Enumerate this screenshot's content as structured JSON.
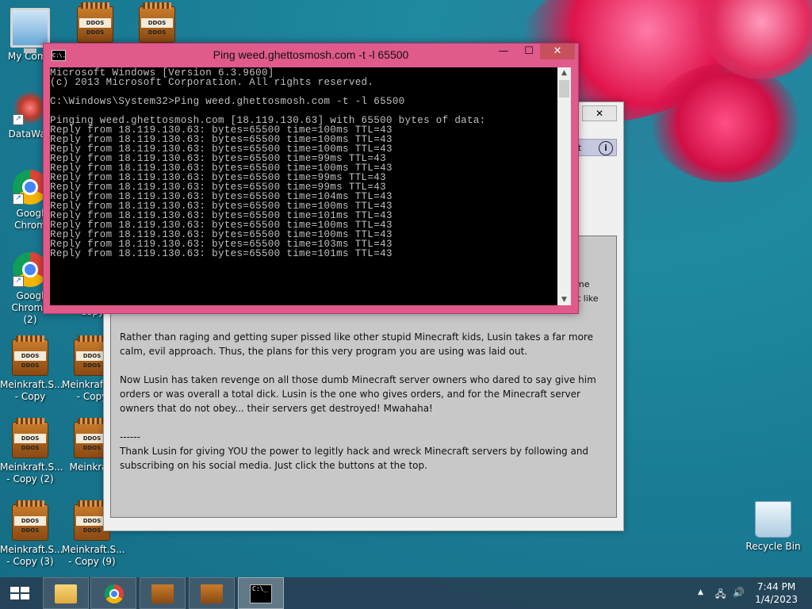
{
  "desktop": {
    "icons": [
      {
        "label": "My Comp",
        "kind": "computer"
      },
      {
        "label": "DataWag",
        "kind": "datawag"
      },
      {
        "label": "Googl Chrom",
        "kind": "chrome"
      },
      {
        "label": "Googl Chrome (2)",
        "kind": "chrome"
      },
      {
        "label": "Meinkraft.S... - Copy",
        "kind": "rar"
      },
      {
        "label": "Meinkraft.S... - Copy",
        "kind": "rar"
      },
      {
        "label": "Meinkraft.S... - Copy (2)",
        "kind": "rar"
      },
      {
        "label": "Meinkraft",
        "kind": "rar"
      },
      {
        "label": "Meinkraft.S... - Copy (3)",
        "kind": "rar"
      },
      {
        "label": "Meinkraft.S... - Copy (9)",
        "kind": "rar"
      },
      {
        "label": "Recycle Bin",
        "kind": "recycle"
      }
    ],
    "rar_tag": "DDOS DDOS",
    "copy_fragment": "Copy"
  },
  "bg_window": {
    "close_label": "✕",
    "about_label": "out",
    "info_glyph": "i",
    "right_fragments": [
      "me",
      "elt like"
    ],
    "paragraphs": [
      "Rather than raging and getting super pissed like other stupid Minecraft kids, Lusin takes a far more calm, evil approach.  Thus, the plans for this very program you are using was laid out.",
      "Now Lusin has taken revenge on all those dumb Minecraft server owners who dared to say give him orders or was overall a total dick.  Lusin is the one who gives orders, and for the Minecraft server owners that do not obey... their servers get destroyed!  Mwahaha!",
      "------",
      "Thank Lusin for giving YOU the power to legitly hack and wreck Minecraft servers by following and subscribing on his social media.  Just click the buttons at the top."
    ]
  },
  "cmd": {
    "title": "Ping  weed.ghettosmosh.com -t -l 65500",
    "icon_text": "C:\\.",
    "minimize": "—",
    "maximize": "☐",
    "close": "✕",
    "lines": [
      "Microsoft Windows [Version 6.3.9600]",
      "(c) 2013 Microsoft Corporation. All rights reserved.",
      "",
      "C:\\Windows\\System32>Ping weed.ghettosmosh.com -t -l 65500",
      "",
      "Pinging weed.ghettosmosh.com [18.119.130.63] with 65500 bytes of data:",
      "Reply from 18.119.130.63: bytes=65500 time=100ms TTL=43",
      "Reply from 18.119.130.63: bytes=65500 time=100ms TTL=43",
      "Reply from 18.119.130.63: bytes=65500 time=100ms TTL=43",
      "Reply from 18.119.130.63: bytes=65500 time=99ms TTL=43",
      "Reply from 18.119.130.63: bytes=65500 time=100ms TTL=43",
      "Reply from 18.119.130.63: bytes=65500 time=99ms TTL=43",
      "Reply from 18.119.130.63: bytes=65500 time=99ms TTL=43",
      "Reply from 18.119.130.63: bytes=65500 time=104ms TTL=43",
      "Reply from 18.119.130.63: bytes=65500 time=100ms TTL=43",
      "Reply from 18.119.130.63: bytes=65500 time=101ms TTL=43",
      "Reply from 18.119.130.63: bytes=65500 time=100ms TTL=43",
      "Reply from 18.119.130.63: bytes=65500 time=100ms TTL=43",
      "Reply from 18.119.130.63: bytes=65500 time=103ms TTL=43",
      "Reply from 18.119.130.63: bytes=65500 time=101ms TTL=43"
    ]
  },
  "taskbar": {
    "cmd_icon_text": "C:\\_",
    "tray_arrow": "▲",
    "tray_network": "🖧",
    "tray_volume": "🔊",
    "time": "7:44 PM",
    "date": "1/4/2023"
  },
  "colors": {
    "cmd_frame": "#e05a8c",
    "cmd_close": "#c7505c",
    "desktop": "#1a7c95"
  }
}
